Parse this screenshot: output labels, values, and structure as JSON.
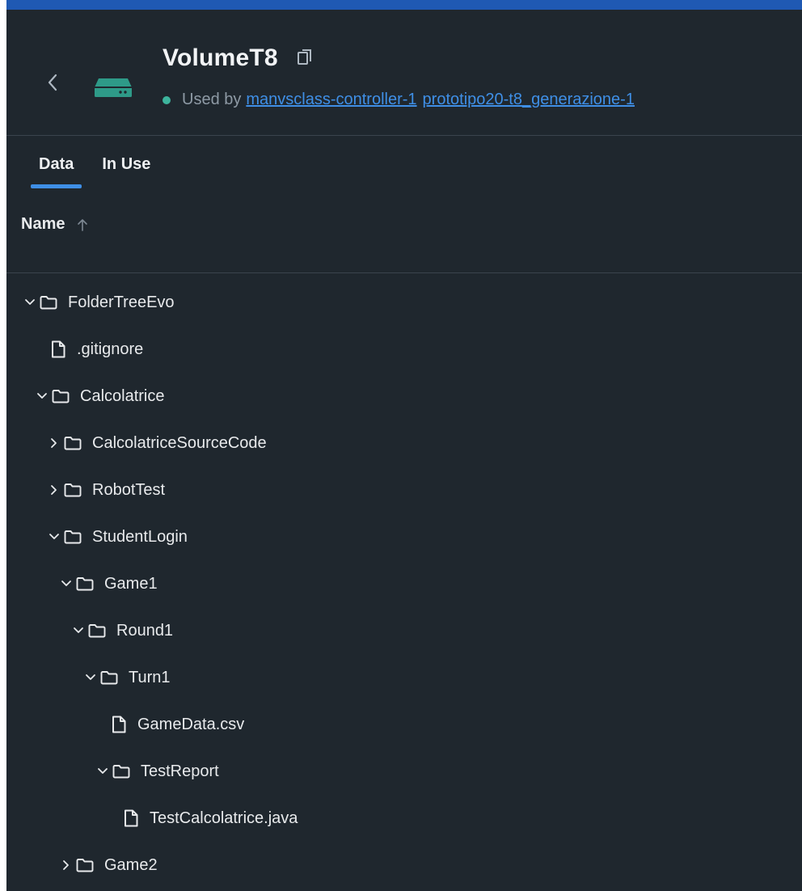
{
  "volume": {
    "title": "VolumeT8",
    "used_by_label": "Used by",
    "status_color": "#3db49d",
    "containers": [
      "manvsclass-controller-1",
      "prototipo20-t8_generazione-1"
    ]
  },
  "icons": {
    "back": "chevron-left-icon",
    "volume": "hard-drive-icon",
    "copy": "copy-icon",
    "sort": "arrow-up-icon",
    "folder": "folder-icon",
    "file": "file-icon",
    "expanded": "chevron-down-icon",
    "collapsed": "chevron-right-icon"
  },
  "tabs": [
    {
      "label": "Data",
      "active": true
    },
    {
      "label": "In Use",
      "active": false
    }
  ],
  "table": {
    "name_column": "Name",
    "sort": "ascending"
  },
  "tree": [
    {
      "name": "FolderTreeEvo",
      "kind": "folder",
      "depth": 0,
      "expanded": true
    },
    {
      "name": ".gitignore",
      "kind": "file",
      "depth": 1
    },
    {
      "name": "Calcolatrice",
      "kind": "folder",
      "depth": 1,
      "expanded": true
    },
    {
      "name": "CalcolatriceSourceCode",
      "kind": "folder",
      "depth": 2,
      "expanded": false
    },
    {
      "name": "RobotTest",
      "kind": "folder",
      "depth": 2,
      "expanded": false
    },
    {
      "name": "StudentLogin",
      "kind": "folder",
      "depth": 2,
      "expanded": true
    },
    {
      "name": "Game1",
      "kind": "folder",
      "depth": 3,
      "expanded": true
    },
    {
      "name": "Round1",
      "kind": "folder",
      "depth": 4,
      "expanded": true
    },
    {
      "name": "Turn1",
      "kind": "folder",
      "depth": 5,
      "expanded": true
    },
    {
      "name": "GameData.csv",
      "kind": "file",
      "depth": 6
    },
    {
      "name": "TestReport",
      "kind": "folder",
      "depth": 6,
      "expanded": true
    },
    {
      "name": "TestCalcolatrice.java",
      "kind": "file",
      "depth": 7
    },
    {
      "name": "Game2",
      "kind": "folder",
      "depth": 3,
      "expanded": false
    }
  ]
}
